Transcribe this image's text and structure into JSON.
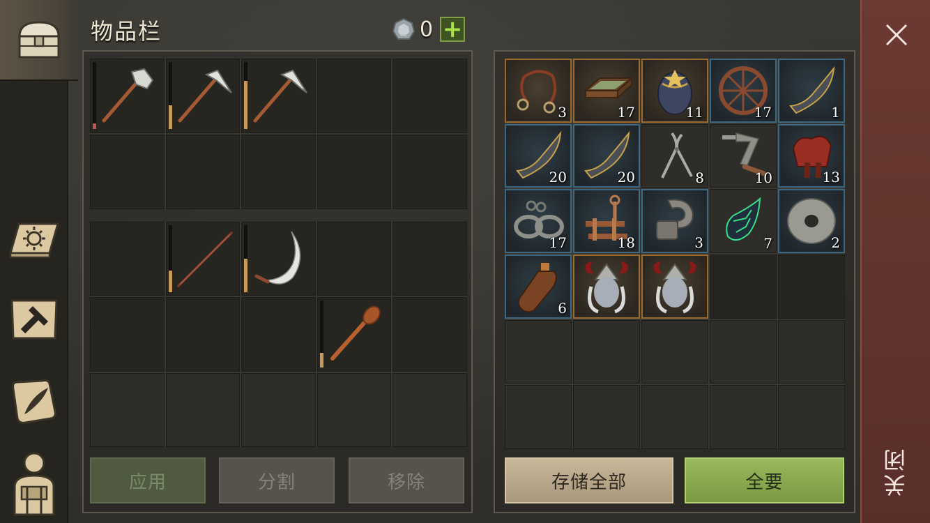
{
  "header": {
    "title": "物品栏",
    "currency_amount": "0"
  },
  "sidebar": {
    "tabs": [
      {
        "icon": "chest-icon"
      },
      {
        "icon": "sun-book-icon"
      },
      {
        "icon": "hammer-map-icon"
      },
      {
        "icon": "scroll-quill-icon"
      },
      {
        "icon": "backpack-person-icon"
      }
    ]
  },
  "inventory": {
    "slots_top": [
      {
        "icon": "stone-hammer-icon",
        "durability": 0.08,
        "durability_color": "#c0544a"
      },
      {
        "icon": "pickaxe-icon",
        "durability": 0.35
      },
      {
        "icon": "pickaxe-icon",
        "durability": 0.72
      }
    ],
    "slots_mid": [
      {
        "icon": "wooden-spear-icon",
        "durability": 0.32
      },
      {
        "icon": "sickle-icon",
        "durability": 0.5
      },
      {
        "icon": "wooden-club-icon",
        "durability": 0.22
      }
    ]
  },
  "storage": {
    "items": [
      {
        "icon": "leather-bridle-icon",
        "count": "3",
        "rarity": "orange"
      },
      {
        "icon": "wooden-tray-icon",
        "count": "17",
        "rarity": "orange"
      },
      {
        "icon": "ornate-egg-icon",
        "count": "11",
        "rarity": "orange"
      },
      {
        "icon": "wagon-wheel-icon",
        "count": "17",
        "rarity": "blue"
      },
      {
        "icon": "blade-fragment-icon",
        "count": "1",
        "rarity": "blue"
      },
      {
        "icon": "blade-fragment-icon",
        "count": "20",
        "rarity": "blue"
      },
      {
        "icon": "blade-fragment-icon",
        "count": "20",
        "rarity": "blue"
      },
      {
        "icon": "pliers-icon",
        "count": "8",
        "rarity": "dim"
      },
      {
        "icon": "crank-handle-icon",
        "count": "10",
        "rarity": "dim"
      },
      {
        "icon": "saddle-icon",
        "count": "13",
        "rarity": "blue"
      },
      {
        "icon": "shackles-chain-icon",
        "count": "17",
        "rarity": "blue"
      },
      {
        "icon": "bronze-mechanism-icon",
        "count": "18",
        "rarity": "blue"
      },
      {
        "icon": "metal-clamp-icon",
        "count": "3",
        "rarity": "blue"
      },
      {
        "icon": "green-crystal-icon",
        "count": "7",
        "rarity": "dim"
      },
      {
        "icon": "grinding-stone-icon",
        "count": "2",
        "rarity": "blue"
      },
      {
        "icon": "bottle-icon",
        "count": "6",
        "rarity": "blue"
      },
      {
        "icon": "horned-helmet-head-icon",
        "count": "",
        "rarity": "orange"
      },
      {
        "icon": "horned-helmet-head-icon",
        "count": "",
        "rarity": "orange"
      }
    ]
  },
  "buttons": {
    "apply": "应用",
    "split": "分割",
    "remove": "移除",
    "store_all": "存储全部",
    "take_all": "全要",
    "close": "关闭"
  }
}
